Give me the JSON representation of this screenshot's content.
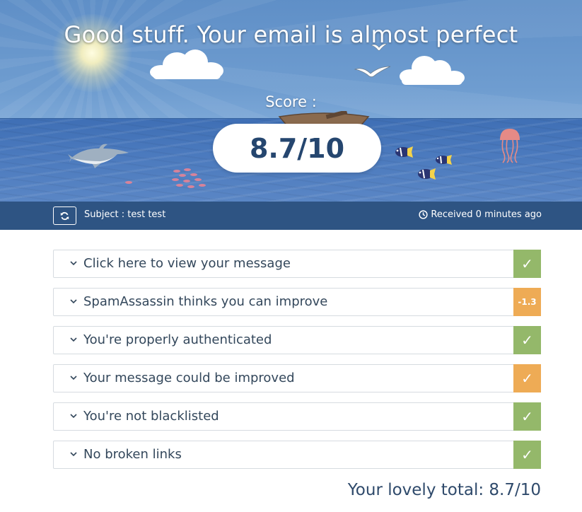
{
  "hero": {
    "headline": "Good stuff. Your email is almost perfect",
    "score_label": "Score :",
    "score_value": "8.7/10"
  },
  "subject_bar": {
    "subject": "Subject : test test",
    "received": "Received 0 minutes ago"
  },
  "results": [
    {
      "label": "Click here to view your message",
      "status": "pass",
      "badge": "✓",
      "color": "#94b86a"
    },
    {
      "label": "SpamAssassin thinks you can improve",
      "status": "warn",
      "badge": "-1.3",
      "color": "#eeab55"
    },
    {
      "label": "You're properly authenticated",
      "status": "pass",
      "badge": "✓",
      "color": "#94b86a"
    },
    {
      "label": "Your message could be improved",
      "status": "warn",
      "badge": "✓",
      "color": "#eeab55"
    },
    {
      "label": "You're not blacklisted",
      "status": "pass",
      "badge": "✓",
      "color": "#94b86a"
    },
    {
      "label": "No broken links",
      "status": "pass",
      "badge": "✓",
      "color": "#94b86a"
    }
  ],
  "total": "Your lovely total: 8.7/10",
  "colors": {
    "bar": "#2e5483",
    "score_text": "#25466f",
    "pass": "#94b86a",
    "warn": "#eeab55"
  },
  "icons": [
    "refresh-icon",
    "clock-icon",
    "chevron-down-icon",
    "check-icon"
  ]
}
